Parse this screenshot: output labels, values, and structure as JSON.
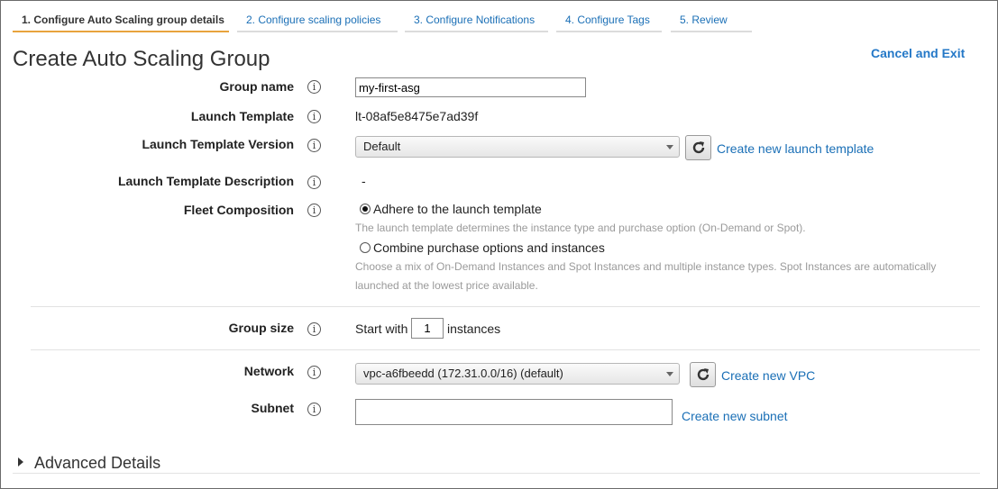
{
  "tabs": [
    {
      "label": "1. Configure Auto Scaling group details",
      "active": true
    },
    {
      "label": "2. Configure scaling policies"
    },
    {
      "label": "3. Configure Notifications"
    },
    {
      "label": "4. Configure Tags"
    },
    {
      "label": "5. Review"
    }
  ],
  "page": {
    "title": "Create Auto Scaling Group",
    "cancel_label": "Cancel and Exit"
  },
  "form": {
    "group_name": {
      "label": "Group name",
      "value": "my-first-asg"
    },
    "launch_template": {
      "label": "Launch Template",
      "value": "lt-08af5e8475e7ad39f"
    },
    "launch_template_version": {
      "label": "Launch Template Version",
      "selected": "Default",
      "create_link": "Create new launch template"
    },
    "launch_template_description": {
      "label": "Launch Template Description",
      "value": "-"
    },
    "fleet_composition": {
      "label": "Fleet Composition",
      "options": [
        {
          "label": "Adhere to the launch template",
          "checked": true,
          "help": "The launch template determines the instance type and purchase option (On-Demand or Spot)."
        },
        {
          "label": "Combine purchase options and instances",
          "checked": false,
          "help_line1": "Choose a mix of On-Demand Instances and Spot Instances and multiple instance types. Spot Instances are automatically",
          "help_line2": "launched at the lowest price available."
        }
      ]
    },
    "group_size": {
      "label": "Group size",
      "prefix": "Start with",
      "value": "1",
      "suffix": "instances"
    },
    "network": {
      "label": "Network",
      "selected": "vpc-a6fbeedd (172.31.0.0/16) (default)",
      "create_link": "Create new VPC"
    },
    "subnet": {
      "label": "Subnet",
      "value": "",
      "create_link": "Create new subnet"
    }
  },
  "advanced": {
    "label": "Advanced Details"
  },
  "icons": {
    "info": "i",
    "refresh": "refresh-icon",
    "caret": "caret-right-icon"
  },
  "colors": {
    "accent": "#e8a33d",
    "link": "#1a6fb6"
  }
}
